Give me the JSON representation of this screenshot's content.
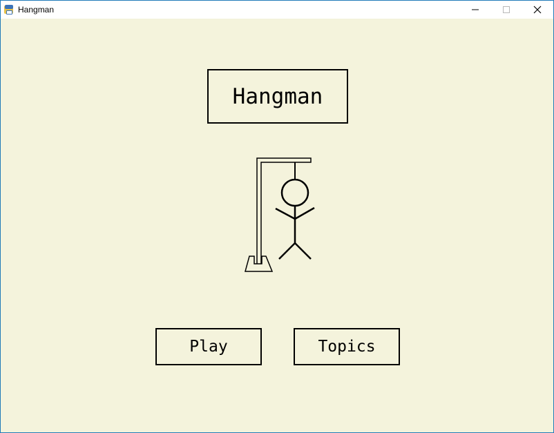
{
  "window": {
    "title": "Hangman",
    "icon": "python-app-icon",
    "controls": {
      "minimize": "minimize-icon",
      "maximize": "maximize-icon",
      "close": "close-icon"
    }
  },
  "main": {
    "heading": "Hangman",
    "illustration": "hangman-figure",
    "buttons": {
      "play_label": "Play",
      "topics_label": "Topics"
    }
  },
  "colors": {
    "background": "#f4f3dc",
    "titlebar": "#ffffff",
    "border": "#1f7ab8",
    "ink": "#000000"
  }
}
